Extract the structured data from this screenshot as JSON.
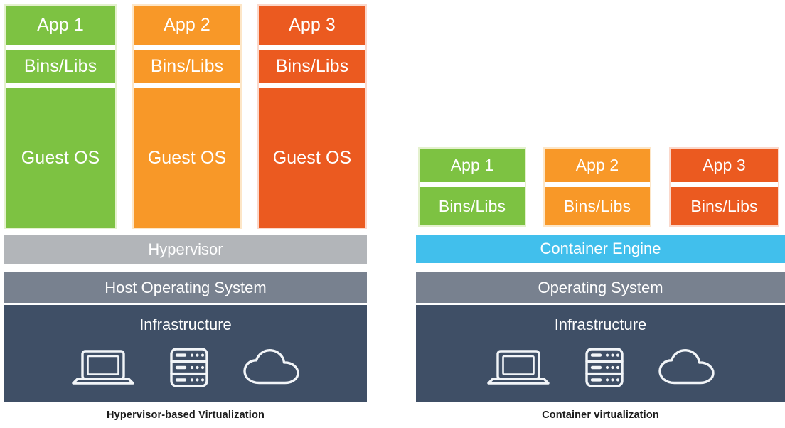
{
  "palette": {
    "green": "#7DC242",
    "green_border": "#E4F1CE",
    "orange": "#F89828",
    "orange_border": "#FDE6C7",
    "red": "#EB5A20",
    "red_border": "#FBD8CB",
    "hypervisor_gray": "#B2B5B9",
    "host_os_gray": "#78818F",
    "infrastructure_navy": "#3F4F66",
    "container_engine_blue": "#41BFEC",
    "white": "#FFFFFF",
    "caption_text": "#1B1B1B"
  },
  "left": {
    "caption": "Hypervisor-based Virtualization",
    "columns": [
      {
        "app_label": "App 1",
        "bins_label": "Bins/Libs",
        "os_label": "Guest OS",
        "color": "#7DC242",
        "border": "#E4F1CE"
      },
      {
        "app_label": "App 2",
        "bins_label": "Bins/Libs",
        "os_label": "Guest OS",
        "color": "#F89828",
        "border": "#FDE6C7"
      },
      {
        "app_label": "App 3",
        "bins_label": "Bins/Libs",
        "os_label": "Guest OS",
        "color": "#EB5A20",
        "border": "#FBD8CB"
      }
    ],
    "layers": [
      {
        "label": "Hypervisor",
        "color": "#B2B5B9"
      },
      {
        "label": "Host Operating System",
        "color": "#78818F"
      },
      {
        "label": "Infrastructure",
        "color": "#3F4F66"
      }
    ],
    "infrastructure_icons": [
      "laptop-icon",
      "server-rack-icon",
      "cloud-icon"
    ]
  },
  "right": {
    "caption": "Container virtualization",
    "columns": [
      {
        "app_label": "App 1",
        "bins_label": "Bins/Libs",
        "color": "#7DC242",
        "border": "#E4F1CE"
      },
      {
        "app_label": "App 2",
        "bins_label": "Bins/Libs",
        "color": "#F89828",
        "border": "#FDE6C7"
      },
      {
        "app_label": "App 3",
        "bins_label": "Bins/Libs",
        "color": "#EB5A20",
        "border": "#FBD8CB"
      }
    ],
    "layers": [
      {
        "label": "Container Engine",
        "color": "#41BFEC"
      },
      {
        "label": "Operating System",
        "color": "#78818F"
      },
      {
        "label": "Infrastructure",
        "color": "#3F4F66"
      }
    ],
    "infrastructure_icons": [
      "laptop-icon",
      "server-rack-icon",
      "cloud-icon"
    ]
  }
}
